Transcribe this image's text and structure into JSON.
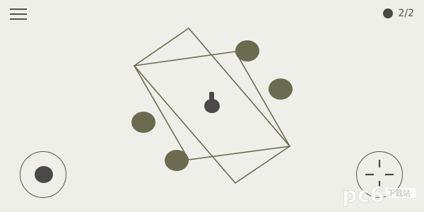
{
  "hud": {
    "menu_icon": "hamburger-menu-icon",
    "counter_icon": "filled-dot-icon",
    "counter_text": "2/2"
  },
  "controls": {
    "move_icon": "joystick-icon",
    "fire_icon": "crosshair-icon"
  },
  "colors": {
    "background": "#efefea",
    "line": "#6b6b50",
    "node": "#6b6b50",
    "player": "#4a4848"
  },
  "watermark": {
    "logo_text": "pc6",
    "sub_text": "下载站"
  }
}
